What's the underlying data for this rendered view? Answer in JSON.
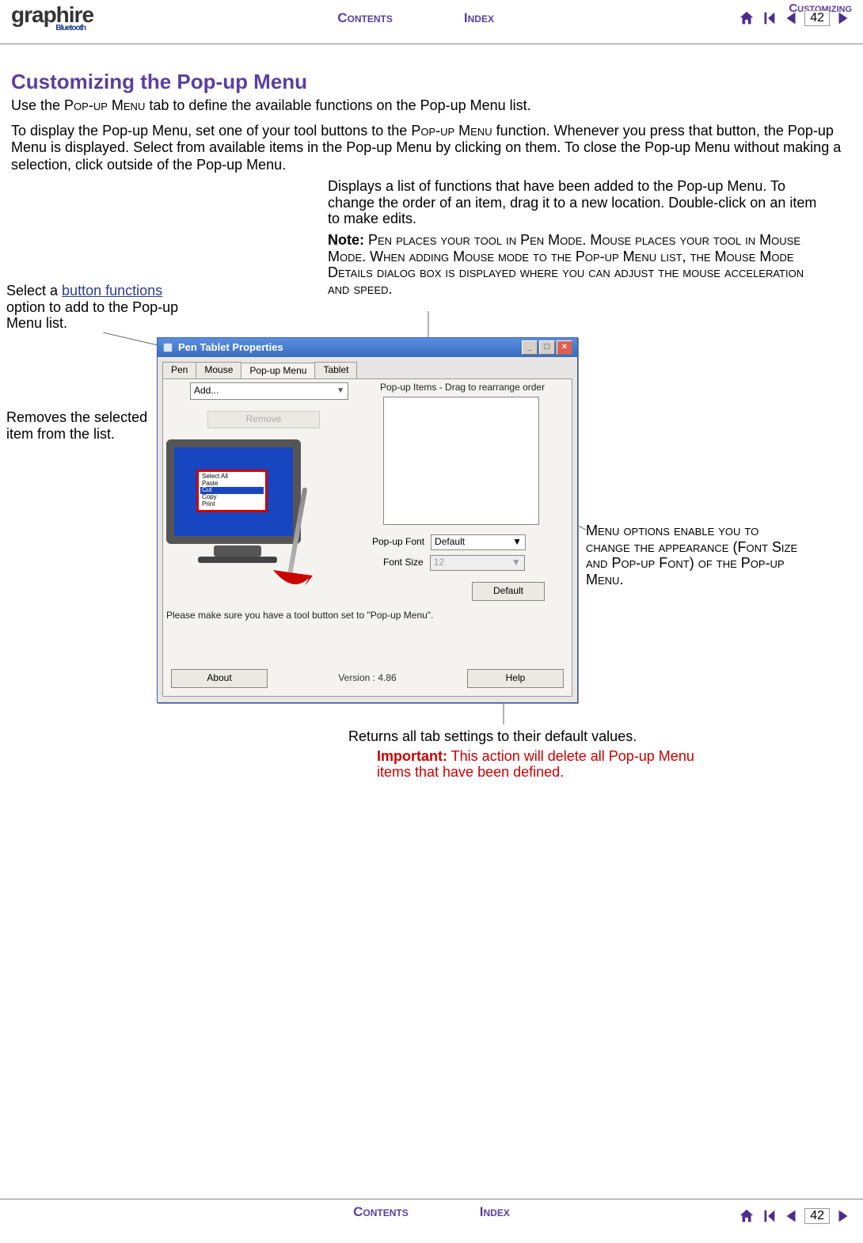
{
  "brand": {
    "name": "graphire",
    "sub": "Bluetooth"
  },
  "nav": {
    "customizing": "Customizing",
    "contents": "Contents",
    "index": "Index",
    "page": "42"
  },
  "title": "Customizing the Pop-up Menu",
  "intro1_a": "Use the ",
  "intro1_b": "Pop-up Menu",
  "intro1_c": " tab to define the available functions on the Pop-up Menu list.",
  "intro2_a": "To display the Pop-up Menu, set one of your tool buttons to the ",
  "intro2_b": "Pop-up Menu",
  "intro2_c": " function.  Whenever you press that button, the Pop-up Menu is displayed.  Select from available items in the Pop-up Menu by clicking on them.  To close the Pop-up Menu without making a selection, click outside of the Pop-up Menu.",
  "callouts": {
    "top_right_p1": "Displays a list of functions that have been added to the Pop-up Menu.  To change the order of an item, drag it to a new location.  Double-click on an item to make edits.",
    "top_right_note_label": "Note:",
    "top_right_note_a": " Pen places your tool in Pen Mode.  Mouse places your tool in Mouse Mode.  When adding Mouse mode to the Pop-up Menu list, the Mouse Mode Details dialog box is displayed where you can adjust the mouse acceleration and speed.",
    "left1_a": "Select a ",
    "left1_link": "button functions",
    "left1_b": " option to add to the Pop-up Menu list.",
    "left2": "Removes the selected item from the list.",
    "right_a": "Menu options enable you to change the appearance (Font Size and Pop-up Font) of the Pop-up Menu.",
    "bottom_main": "Returns all tab settings to their default values.",
    "bottom_imp_label": "Important:",
    "bottom_imp_text": " This action will delete all Pop-up Menu items that have been defined."
  },
  "dialog": {
    "title": "Pen Tablet Properties",
    "tabs": [
      "Pen",
      "Mouse",
      "Pop-up Menu",
      "Tablet"
    ],
    "active_tab": 2,
    "add_label": "Add...",
    "remove_label": "Remove",
    "popup_items_label": "Pop-up Items - Drag to rearrange order",
    "popup_font_label": "Pop-up Font",
    "popup_font_value": "Default",
    "font_size_label": "Font Size",
    "font_size_value": "12",
    "default_btn": "Default",
    "hint": "Please make sure you have a tool button set to \"Pop-up Menu\".",
    "about_btn": "About",
    "version_label": "Version : 4.86",
    "help_btn": "Help",
    "mini_menu": [
      "Select All",
      "Paste",
      "Cut",
      "Copy",
      "Print"
    ]
  }
}
